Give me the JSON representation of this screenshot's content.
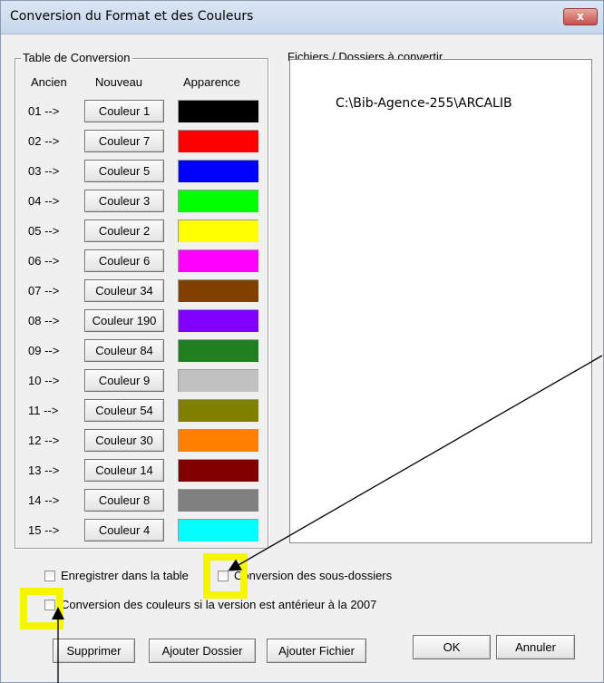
{
  "window": {
    "title": "Conversion du Format et des Couleurs",
    "close_label": "x"
  },
  "conversion_table": {
    "legend": "Table de Conversion",
    "headers": {
      "old": "Ancien",
      "new": "Nouveau",
      "appearance": "Apparence"
    },
    "rows": [
      {
        "old": "01  -->",
        "new": "Couleur 1",
        "color": "#000000"
      },
      {
        "old": "02  -->",
        "new": "Couleur 7",
        "color": "#ff0000"
      },
      {
        "old": "03  -->",
        "new": "Couleur 5",
        "color": "#0000ff"
      },
      {
        "old": "04  -->",
        "new": "Couleur 3",
        "color": "#00ff00"
      },
      {
        "old": "05  -->",
        "new": "Couleur 2",
        "color": "#ffff00"
      },
      {
        "old": "06  -->",
        "new": "Couleur 6",
        "color": "#ff00ff"
      },
      {
        "old": "07  -->",
        "new": "Couleur 34",
        "color": "#804000"
      },
      {
        "old": "08  -->",
        "new": "Couleur 190",
        "color": "#8000ff"
      },
      {
        "old": "09  -->",
        "new": "Couleur 84",
        "color": "#208020"
      },
      {
        "old": "10  -->",
        "new": "Couleur 9",
        "color": "#c0c0c0"
      },
      {
        "old": "11  -->",
        "new": "Couleur 54",
        "color": "#808000"
      },
      {
        "old": "12  -->",
        "new": "Couleur 30",
        "color": "#ff8000"
      },
      {
        "old": "13  -->",
        "new": "Couleur 14",
        "color": "#800000"
      },
      {
        "old": "14  -->",
        "new": "Couleur 8",
        "color": "#808080"
      },
      {
        "old": "15  -->",
        "new": "Couleur 4",
        "color": "#00ffff"
      }
    ]
  },
  "files": {
    "legend": "Fichiers / Dossiers à convertir",
    "items": [
      "C:\\Bib-Agence-255\\ARCALIB"
    ]
  },
  "options": {
    "save_in_table": "Enregistrer dans la table",
    "convert_subfolders": "Conversion des sous-dossiers",
    "convert_colors_pre2007": "Conversion des couleurs si la version est antérieur à la 2007"
  },
  "buttons": {
    "delete": "Supprimer",
    "add_folder": "Ajouter Dossier",
    "add_file": "Ajouter Fichier",
    "ok": "OK",
    "cancel": "Annuler"
  },
  "annotation": {
    "highlight_color": "#f6f600",
    "arrow_color": "#000000"
  }
}
